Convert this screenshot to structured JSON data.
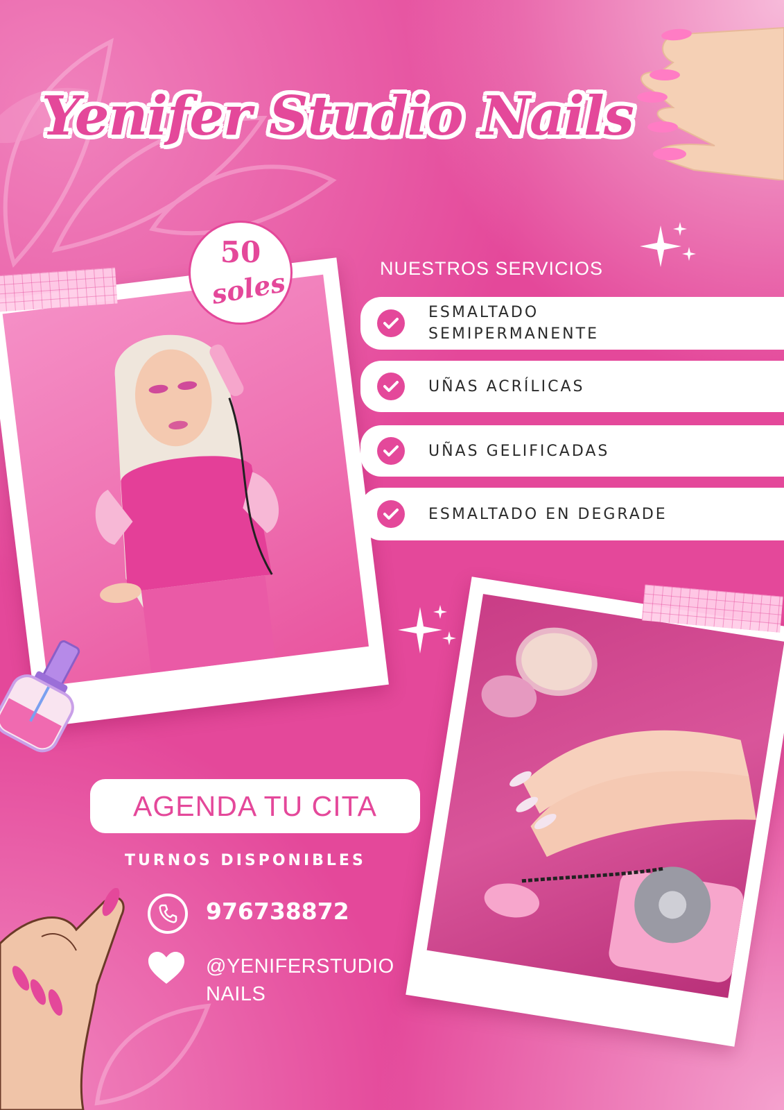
{
  "header": {
    "title": "Yenifer Studio Nails"
  },
  "price_badge": {
    "amount": "50",
    "unit": "soles"
  },
  "services": {
    "heading": "NUESTROS SERVICIOS",
    "items": [
      {
        "label": "ESMALTADO SEMIPERMANENTE"
      },
      {
        "label": "UÑAS ACRÍLICAS"
      },
      {
        "label": "UÑAS GELIFICADAS"
      },
      {
        "label": "ESMALTADO EN DEGRADE"
      }
    ]
  },
  "cta": {
    "label": "AGENDA TU CITA"
  },
  "contact": {
    "subtitle": "TURNOS DISPONIBLES",
    "phone": "976738872",
    "instagram": "@YENIFERSTUDIO NAILS"
  },
  "icons": [
    "check-icon",
    "phone-icon",
    "heart-icon",
    "sparkle-icon",
    "nail-polish-icon"
  ],
  "colors": {
    "brand_pink": "#e4489a",
    "white": "#ffffff",
    "light_pink": "#ffc8e3"
  }
}
